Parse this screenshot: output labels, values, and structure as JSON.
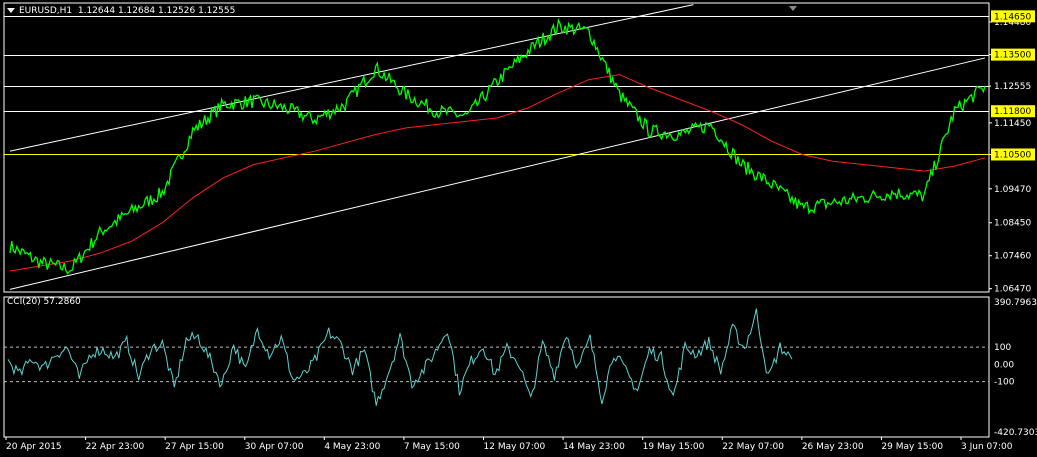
{
  "header": {
    "symbol": "EURUSD,H1",
    "ohlc": "1.12644 1.12684 1.12526 1.12555"
  },
  "indicator": {
    "label": "CCI(20) 57.2860",
    "axis_labels": [
      "390.7963",
      "100",
      "0.00",
      "-100",
      "-420.7303"
    ]
  },
  "colors": {
    "background": "#000000",
    "price": "#00ff00",
    "ma": "#ff2020",
    "channel": "#ffffff",
    "hline_white": "#ffffff",
    "hline_yellow": "#ffff00",
    "cci": "#5fd3cf",
    "level_box": "#ffff00",
    "axis": "#ffffff"
  },
  "chart_data": [
    {
      "type": "line",
      "series": [
        {
          "name": "",
          "x": [
            "20 Apr 2015",
            "21 Apr 2015",
            "22 Apr 2015",
            "23 Apr 2015",
            "24 Apr 2015",
            "27 Apr 2015",
            "28 Apr 2015",
            "29 Apr 2015",
            "30 Apr 2015",
            "1 May 2015",
            "4 May 2015",
            "5 May 2015",
            "6 May 2015",
            "7 May 2015",
            "8 May 2015",
            "11 May 2015",
            "12 May 2015",
            "13 May 2015",
            "14 May 2015",
            "15 May 2015",
            "18 May 2015",
            "19 May 2015",
            "20 May 2015",
            "21 May 2015",
            "22 May 2015",
            "25 May 2015",
            "26 May 2015",
            "27 May 2015",
            "28 May 2015",
            "29 May 2015",
            "1 Jun 2015",
            "2 Jun 2015",
            "3 Jun 2015"
          ],
          "values": [
            1.0775,
            1.0725,
            1.0705,
            1.082,
            1.088,
            1.0935,
            1.112,
            1.12,
            1.121,
            1.119,
            1.1155,
            1.12,
            1.131,
            1.123,
            1.118,
            1.1165,
            1.127,
            1.136,
            1.1435,
            1.142,
            1.123,
            1.112,
            1.111,
            1.114,
            1.102,
            1.096,
            1.089,
            1.0905,
            1.092,
            1.0935,
            1.0925,
            1.118,
            1.1255
          ]
        }
      ],
      "moving_average": [
        1.07,
        1.0715,
        1.073,
        1.0755,
        1.079,
        1.0845,
        1.092,
        1.098,
        1.102,
        1.104,
        1.106,
        1.1085,
        1.111,
        1.113,
        1.114,
        1.115,
        1.116,
        1.119,
        1.1235,
        1.1275,
        1.129,
        1.125,
        1.1215,
        1.118,
        1.114,
        1.109,
        1.105,
        1.103,
        1.102,
        1.101,
        1.1,
        1.1015,
        1.104
      ],
      "horizontal_levels": [
        {
          "value": 1.1465,
          "label": "1.14650",
          "boxed": true,
          "color": "white"
        },
        {
          "value": 1.135,
          "label": "1.13500",
          "boxed": true,
          "color": "white"
        },
        {
          "value": 1.12555,
          "label": "1.12555",
          "boxed": false,
          "color": "white"
        },
        {
          "value": 1.118,
          "label": "1.11800",
          "boxed": true,
          "color": "white"
        },
        {
          "value": 1.105,
          "label": "1.10500",
          "boxed": true,
          "color": "yellow"
        }
      ],
      "channel_lines": [
        {
          "from": [
            "20 Apr 2015",
            1.106
          ],
          "to": [
            "14 May 2015",
            1.15
          ]
        },
        {
          "from": [
            "20 Apr 2015",
            1.0645
          ],
          "to": [
            "3 Jun 2015",
            1.134
          ]
        }
      ],
      "yticks": [
        "1.14480",
        "1.13500",
        "1.12555",
        "1.11450",
        "1.10500",
        "1.09470",
        "1.08450",
        "1.07460",
        "1.06470"
      ],
      "ylim": [
        1.0637,
        1.1505
      ],
      "xticks": [
        "20 Apr 2015",
        "22 Apr 23:00",
        "27 Apr 15:00",
        "30 Apr 07:00",
        "4 May 23:00",
        "7 May 15:00",
        "12 May 07:00",
        "14 May 23:00",
        "19 May 15:00",
        "22 May 07:00",
        "26 May 23:00",
        "29 May 15:00",
        "3 Jun 07:00"
      ],
      "grid": false
    },
    {
      "type": "line",
      "series": [
        {
          "name": "",
          "values": [
            20,
            -60,
            35,
            -20,
            60,
            95,
            -80,
            70,
            85,
            40,
            130,
            -75,
            90,
            120,
            -140,
            140,
            160,
            30,
            -120,
            115,
            -40,
            210,
            60,
            150,
            -90,
            -60,
            40,
            185,
            120,
            -30,
            80,
            -230,
            -50,
            160,
            -110,
            -30,
            75,
            210,
            -150,
            20,
            110,
            -60,
            90,
            10,
            -210,
            120,
            -60,
            180,
            -20,
            150,
            -200,
            70,
            -40,
            -150,
            80,
            40,
            -190,
            100,
            60,
            130,
            -40,
            210,
            90,
            300,
            -80,
            100,
            30
          ]
        }
      ],
      "levels": [
        100,
        -100
      ],
      "ylim": [
        -420.7303,
        390.7963
      ]
    }
  ]
}
